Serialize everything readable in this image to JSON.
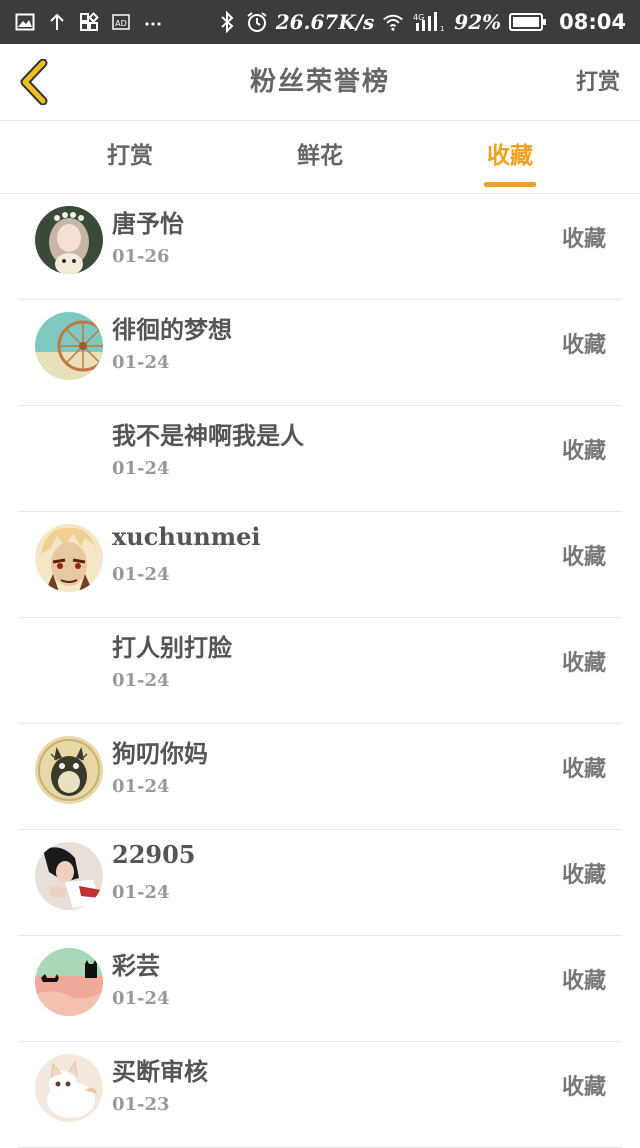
{
  "status_bar": {
    "speed": "26.67K/s",
    "network_type": "4G",
    "battery_percent": "92%",
    "time": "08:04",
    "icons": [
      "image-icon",
      "upload-icon",
      "apps-icon",
      "ad-icon",
      "more-icon",
      "bluetooth-icon",
      "alarm-icon",
      "wifi-icon",
      "signal-icon",
      "battery-icon"
    ]
  },
  "header": {
    "title": "粉丝荣誉榜",
    "action_label": "打赏",
    "back_icon": "chevron-left-icon",
    "back_icon_color": "#f0c020"
  },
  "tabs": [
    {
      "label": "打赏",
      "active": false
    },
    {
      "label": "鲜花",
      "active": false
    },
    {
      "label": "收藏",
      "active": true
    }
  ],
  "accent_color": "#f0a020",
  "list": [
    {
      "name": "唐予怡",
      "date": "01-26",
      "type": "收藏",
      "has_avatar": true,
      "avatar_icon": "girl-with-flower-crown-avatar"
    },
    {
      "name": "徘徊的梦想",
      "date": "01-24",
      "type": "收藏",
      "has_avatar": true,
      "avatar_icon": "ferris-wheel-avatar"
    },
    {
      "name": "我不是神啊我是人",
      "date": "01-24",
      "type": "收藏",
      "has_avatar": false
    },
    {
      "name": "xuchunmei",
      "date": "01-24",
      "type": "收藏",
      "has_avatar": true,
      "avatar_icon": "anime-character-avatar"
    },
    {
      "name": "打人别打脸",
      "date": "01-24",
      "type": "收藏",
      "has_avatar": false
    },
    {
      "name": "狗叨你妈",
      "date": "01-24",
      "type": "收藏",
      "has_avatar": true,
      "avatar_icon": "totoro-avatar"
    },
    {
      "name": "22905",
      "date": "01-24",
      "type": "收藏",
      "has_avatar": true,
      "avatar_icon": "girl-photo-avatar"
    },
    {
      "name": "彩芸",
      "date": "01-24",
      "type": "收藏",
      "has_avatar": true,
      "avatar_icon": "cats-scenery-avatar"
    },
    {
      "name": "买断审核",
      "date": "01-23",
      "type": "收藏",
      "has_avatar": true,
      "avatar_icon": "kitten-avatar"
    }
  ]
}
